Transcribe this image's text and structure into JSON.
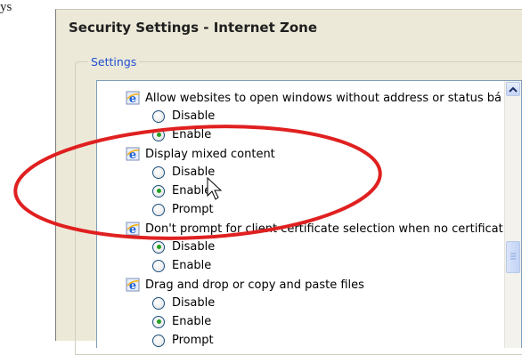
{
  "background_fragment": "ys",
  "dialog": {
    "title": "Security Settings - Internet Zone",
    "group_label": "Settings"
  },
  "settings_list": [
    {
      "label": "Allow websites to open windows without address or status bá",
      "options": [
        {
          "label": "Disable",
          "checked": false
        },
        {
          "label": "Enable",
          "checked": true
        }
      ]
    },
    {
      "label": "Display mixed content",
      "options": [
        {
          "label": "Disable",
          "checked": false
        },
        {
          "label": "Enable",
          "checked": true
        },
        {
          "label": "Prompt",
          "checked": false
        }
      ]
    },
    {
      "label": "Don't prompt for client certificate selection when no certificat",
      "options": [
        {
          "label": "Disable",
          "checked": true
        },
        {
          "label": "Enable",
          "checked": false
        }
      ]
    },
    {
      "label": "Drag and drop or copy and paste files",
      "options": [
        {
          "label": "Disable",
          "checked": false
        },
        {
          "label": "Enable",
          "checked": true
        },
        {
          "label": "Prompt",
          "checked": false
        }
      ]
    }
  ],
  "scrollbar": {
    "up_icon": "scroll-up-arrow-icon",
    "thumb_icon": "scroll-thumb-grip-icon"
  },
  "annotation": {
    "color": "#e02020",
    "shape": "ellipse-highlight"
  },
  "cursor": {
    "icon": "mouse-pointer-icon"
  }
}
